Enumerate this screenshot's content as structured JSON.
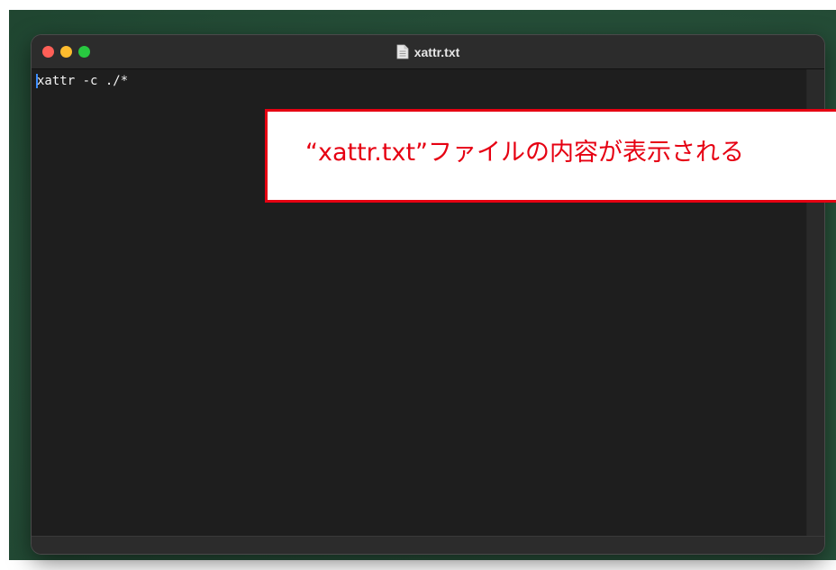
{
  "window": {
    "title": "xattr.txt",
    "title_icon": "document-icon",
    "traffic_lights": {
      "close_color": "#ff5f57",
      "minimize_color": "#febc2e",
      "zoom_color": "#28c840"
    }
  },
  "editor": {
    "content": "xattr -c ./*"
  },
  "annotation": {
    "text": "“xattr.txt”ファイルの内容が表示される",
    "color": "#e60012"
  }
}
